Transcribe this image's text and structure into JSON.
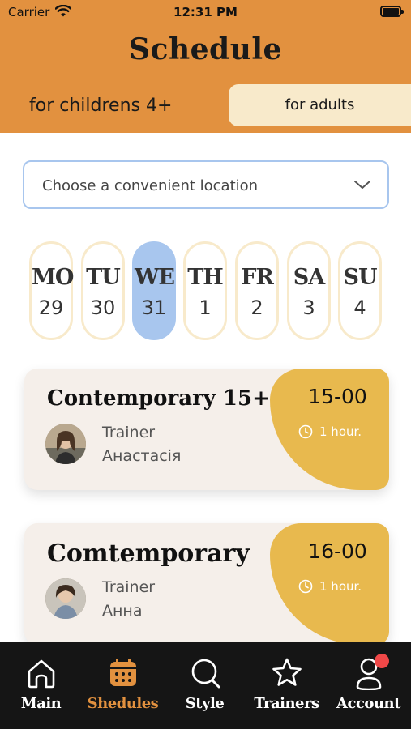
{
  "status_bar": {
    "carrier": "Carrier",
    "time": "12:31 PM"
  },
  "header": {
    "title": "Schedule"
  },
  "tabs": [
    {
      "label": "for childrens 4+",
      "active": true
    },
    {
      "label": "for adults",
      "active": false
    }
  ],
  "location": {
    "placeholder": "Choose a convenient location"
  },
  "days": [
    {
      "abbr": "MO",
      "num": "29",
      "active": false
    },
    {
      "abbr": "TU",
      "num": "30",
      "active": false
    },
    {
      "abbr": "WE",
      "num": "31",
      "active": true
    },
    {
      "abbr": "TH",
      "num": "1",
      "active": false
    },
    {
      "abbr": "FR",
      "num": "2",
      "active": false
    },
    {
      "abbr": "SA",
      "num": "3",
      "active": false
    },
    {
      "abbr": "SU",
      "num": "4",
      "active": false
    }
  ],
  "classes": [
    {
      "name": "Contemporary 15+",
      "time": "15-00",
      "duration": "1 hour.",
      "trainer_label": "Trainer",
      "trainer_name": "Анастасія"
    },
    {
      "name": "Comtemporary",
      "time": "16-00",
      "duration": "1 hour.",
      "trainer_label": "Trainer",
      "trainer_name": "Анна"
    }
  ],
  "nav": [
    {
      "label": "Main",
      "icon": "home-icon",
      "active": false
    },
    {
      "label": "Shedules",
      "icon": "calendar-icon",
      "active": true
    },
    {
      "label": "Style",
      "icon": "search-icon",
      "active": false
    },
    {
      "label": "Trainers",
      "icon": "star-icon",
      "active": false
    },
    {
      "label": "Account",
      "icon": "account-icon",
      "active": false,
      "badge": true
    }
  ],
  "colors": {
    "header": "#E2913F",
    "tab_inactive": "#F8EACB",
    "day_active": "#A8C6EE",
    "card_bg": "#F5EFEA",
    "card_accent": "#E8B94E",
    "nav_bg": "#151515",
    "badge": "#F04848"
  }
}
